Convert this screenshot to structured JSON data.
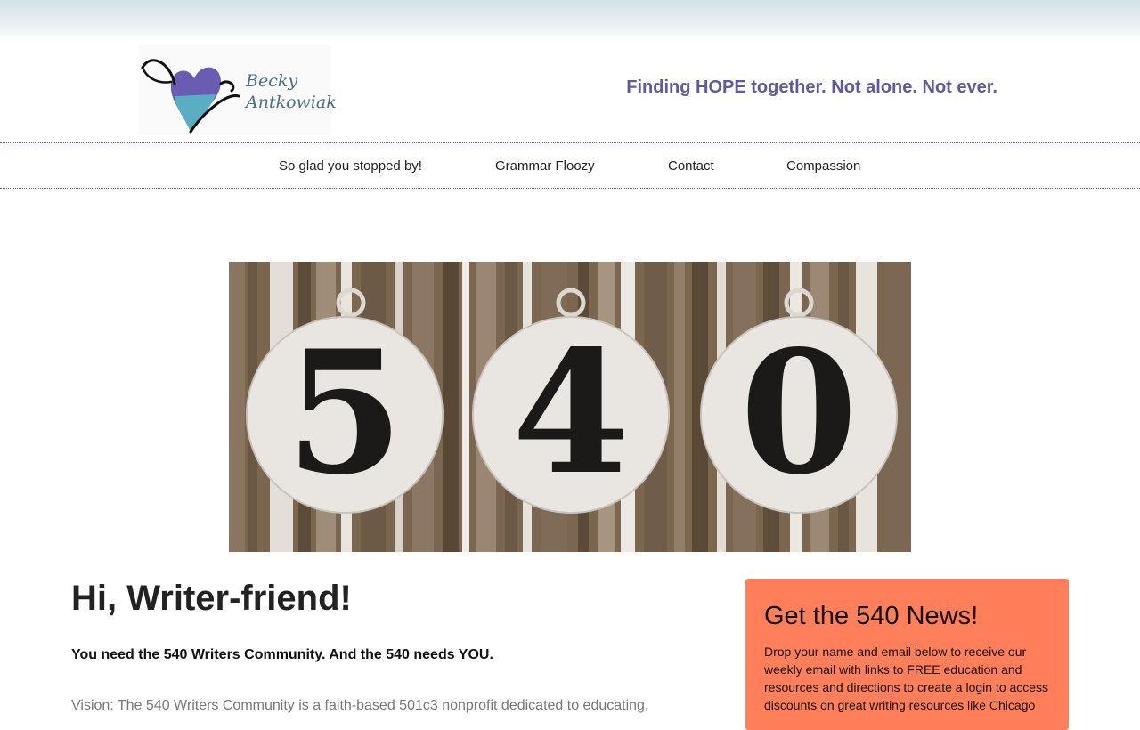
{
  "header": {
    "logo_line1": "Becky",
    "logo_line2": "Antkowiak",
    "tagline": "Finding HOPE together. Not alone. Not ever."
  },
  "nav": {
    "items": [
      "So glad you stopped by!",
      "Grammar Floozy",
      "Contact",
      "Compassion"
    ]
  },
  "hero": {
    "digits": [
      "5",
      "4",
      "0"
    ]
  },
  "content": {
    "title": "Hi, Writer-friend!",
    "lead": "You need the 540 Writers Community. And the 540 needs YOU.",
    "body": "Vision: The 540 Writers Community is a faith-based 501c3 nonprofit dedicated to educating,"
  },
  "sidebar": {
    "heading": "Get the 540 News!",
    "text": "Drop your name and email below to receive our weekly email with links to FREE education and resources and directions to create a login to access discounts on great writing resources like Chicago"
  },
  "colors": {
    "tagline": "#5f5a9f",
    "nav_border": "#8a4aa2",
    "newsletter_bg": "#ff7f5a"
  }
}
